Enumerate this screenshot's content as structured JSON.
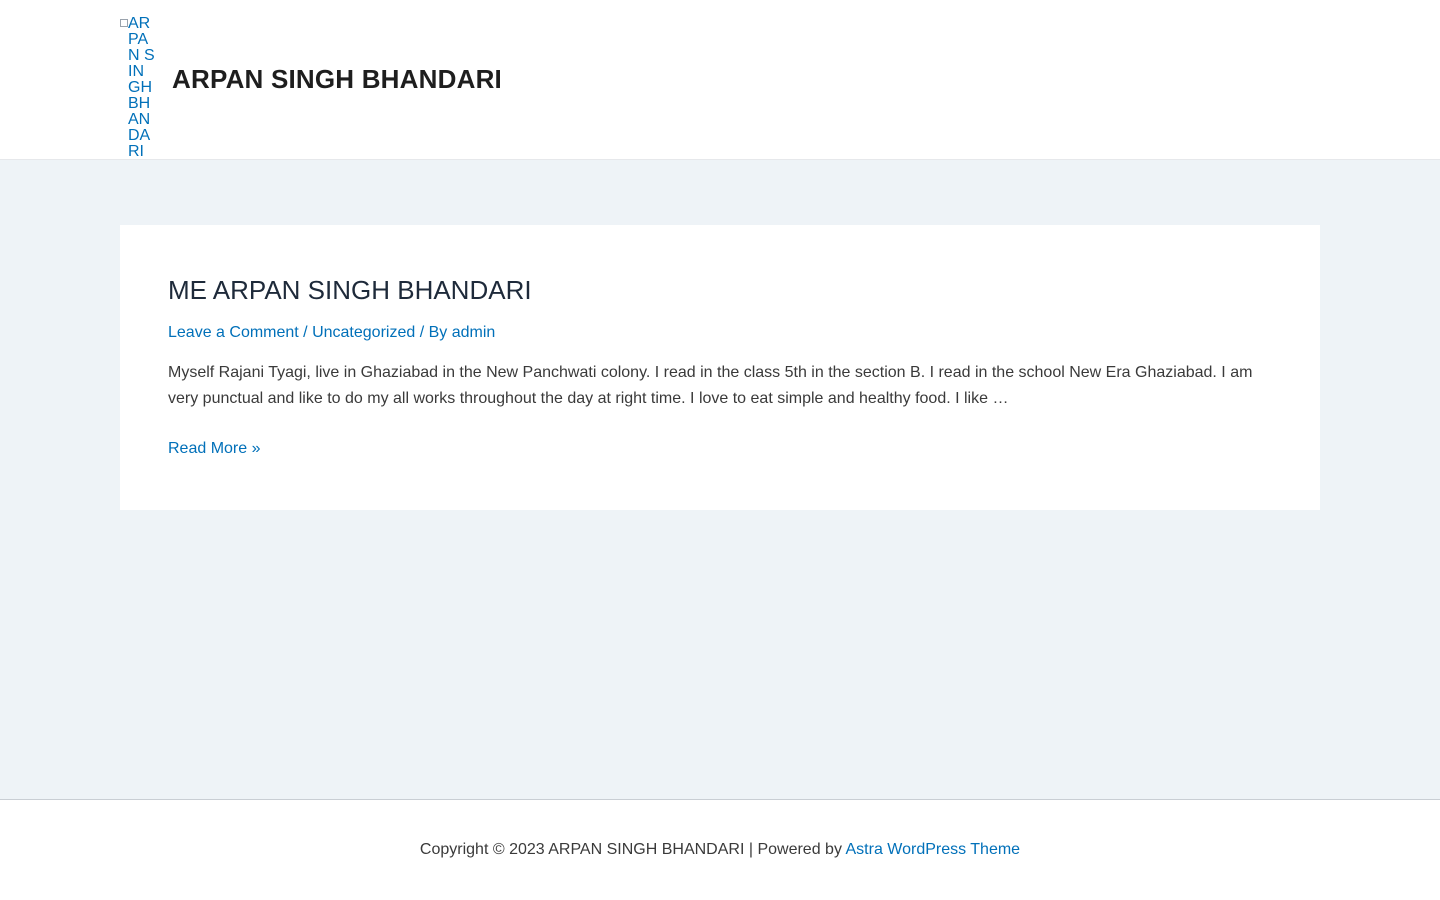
{
  "header": {
    "logo_alt": "ARPAN SINGH BHANDARI",
    "site_title": "ARPAN SINGH BHANDARI"
  },
  "article": {
    "title": "ME ARPAN SINGH BHANDARI",
    "meta": {
      "comments_link": "Leave a Comment",
      "separator1": " / ",
      "category_link": "Uncategorized",
      "by_text": " / By ",
      "author_link": "admin"
    },
    "summary": "Myself Rajani Tyagi, live in Ghaziabad in the New Panchwati colony. I read in the class 5th in the section B. I read in the school New Era Ghaziabad. I am very punctual and like to do my all works throughout the day at right time. I love to eat simple and healthy food. I like …",
    "read_more": "Read More »"
  },
  "footer": {
    "copyright": "Copyright © 2023 ARPAN SINGH BHANDARI | Powered by ",
    "theme_link": "Astra WordPress Theme"
  },
  "colors": {
    "link": "#0170b9",
    "background": "#eef3f7",
    "card": "#ffffff",
    "heading": "#1e2a3a"
  }
}
